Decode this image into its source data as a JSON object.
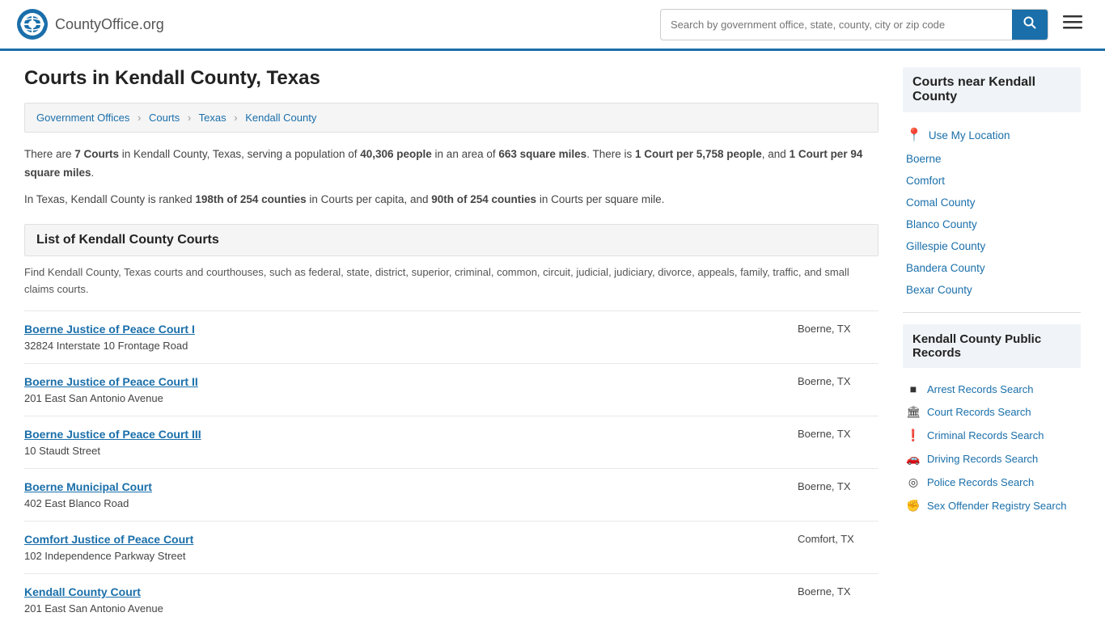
{
  "header": {
    "logo_text": "CountyOffice",
    "logo_suffix": ".org",
    "search_placeholder": "Search by government office, state, county, city or zip code",
    "search_value": ""
  },
  "page": {
    "title": "Courts in Kendall County, Texas"
  },
  "breadcrumb": {
    "items": [
      "Government Offices",
      "Courts",
      "Texas",
      "Kendall County"
    ]
  },
  "info": {
    "line1_pre": "There are ",
    "courts_count": "7 Courts",
    "line1_mid": " in Kendall County, Texas, serving a population of ",
    "population": "40,306 people",
    "line1_mid2": " in an area of ",
    "area": "663 square miles",
    "line1_end": ". There is ",
    "per_people": "1 Court per 5,758 people",
    "and": ", and ",
    "per_sq": "1 Court per 94 square miles",
    "period": ".",
    "line2_pre": "In Texas, Kendall County is ranked ",
    "rank_capita": "198th of 254 counties",
    "line2_mid": " in Courts per capita, and ",
    "rank_sq": "90th of 254 counties",
    "line2_end": " in Courts per square mile."
  },
  "list_section": {
    "title": "List of Kendall County Courts",
    "description": "Find Kendall County, Texas courts and courthouses, such as federal, state, district, superior, criminal, common, circuit, judicial, judiciary, divorce, appeals, family, traffic, and small claims courts."
  },
  "courts": [
    {
      "name": "Boerne Justice of Peace Court I",
      "address": "32824 Interstate 10 Frontage Road",
      "city": "Boerne, TX"
    },
    {
      "name": "Boerne Justice of Peace Court II",
      "address": "201 East San Antonio Avenue",
      "city": "Boerne, TX"
    },
    {
      "name": "Boerne Justice of Peace Court III",
      "address": "10 Staudt Street",
      "city": "Boerne, TX"
    },
    {
      "name": "Boerne Municipal Court",
      "address": "402 East Blanco Road",
      "city": "Boerne, TX"
    },
    {
      "name": "Comfort Justice of Peace Court",
      "address": "102 Independence Parkway Street",
      "city": "Comfort, TX"
    },
    {
      "name": "Kendall County Court",
      "address": "201 East San Antonio Avenue",
      "city": "Boerne, TX"
    }
  ],
  "sidebar": {
    "nearby_title": "Courts near Kendall County",
    "use_my_location": "Use My Location",
    "nearby_links": [
      "Boerne",
      "Comfort",
      "Comal County",
      "Blanco County",
      "Gillespie County",
      "Bandera County",
      "Bexar County"
    ],
    "public_records_title": "Kendall County Public Records",
    "public_records_links": [
      {
        "icon": "■",
        "label": "Arrest Records Search"
      },
      {
        "icon": "🏛",
        "label": "Court Records Search"
      },
      {
        "icon": "❗",
        "label": "Criminal Records Search"
      },
      {
        "icon": "🚗",
        "label": "Driving Records Search"
      },
      {
        "icon": "◎",
        "label": "Police Records Search"
      },
      {
        "icon": "✊",
        "label": "Sex Offender Registry Search"
      }
    ]
  }
}
